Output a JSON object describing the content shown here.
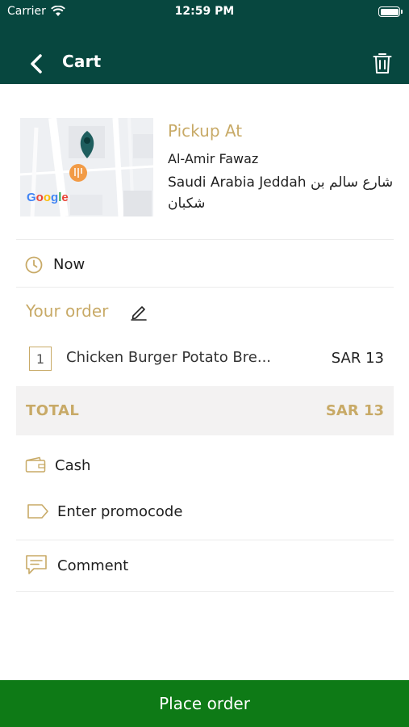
{
  "status_bar": {
    "carrier": "Carrier",
    "time": "12:59 PM"
  },
  "nav": {
    "title": "Cart",
    "back_icon": "chevron-left-icon",
    "delete_icon": "trash-icon"
  },
  "pickup": {
    "label": "Pickup At",
    "vendor": "Al-Amir Fawaz",
    "address": "Saudi Arabia Jeddah شارع سالم بن شكبان",
    "map_brand": "Google"
  },
  "schedule": {
    "label": "Now",
    "icon": "clock-icon"
  },
  "order": {
    "heading": "Your order",
    "edit_icon": "pencil-icon",
    "items": [
      {
        "qty": "1",
        "name": "Chicken Burger Potato Bre...",
        "price": "SAR 13"
      }
    ]
  },
  "total": {
    "label": "TOTAL",
    "value": "SAR 13"
  },
  "payment": {
    "label": "Cash",
    "icon": "wallet-icon"
  },
  "promo": {
    "label": "Enter promocode",
    "icon": "tag-icon"
  },
  "comment": {
    "label": "Comment",
    "icon": "comment-icon"
  },
  "actions": {
    "place_order": "Place order"
  },
  "colors": {
    "header": "#07473f",
    "accent": "#c8aa67",
    "primary_button": "#0e7a16",
    "total_bg": "#f3f2f2"
  }
}
